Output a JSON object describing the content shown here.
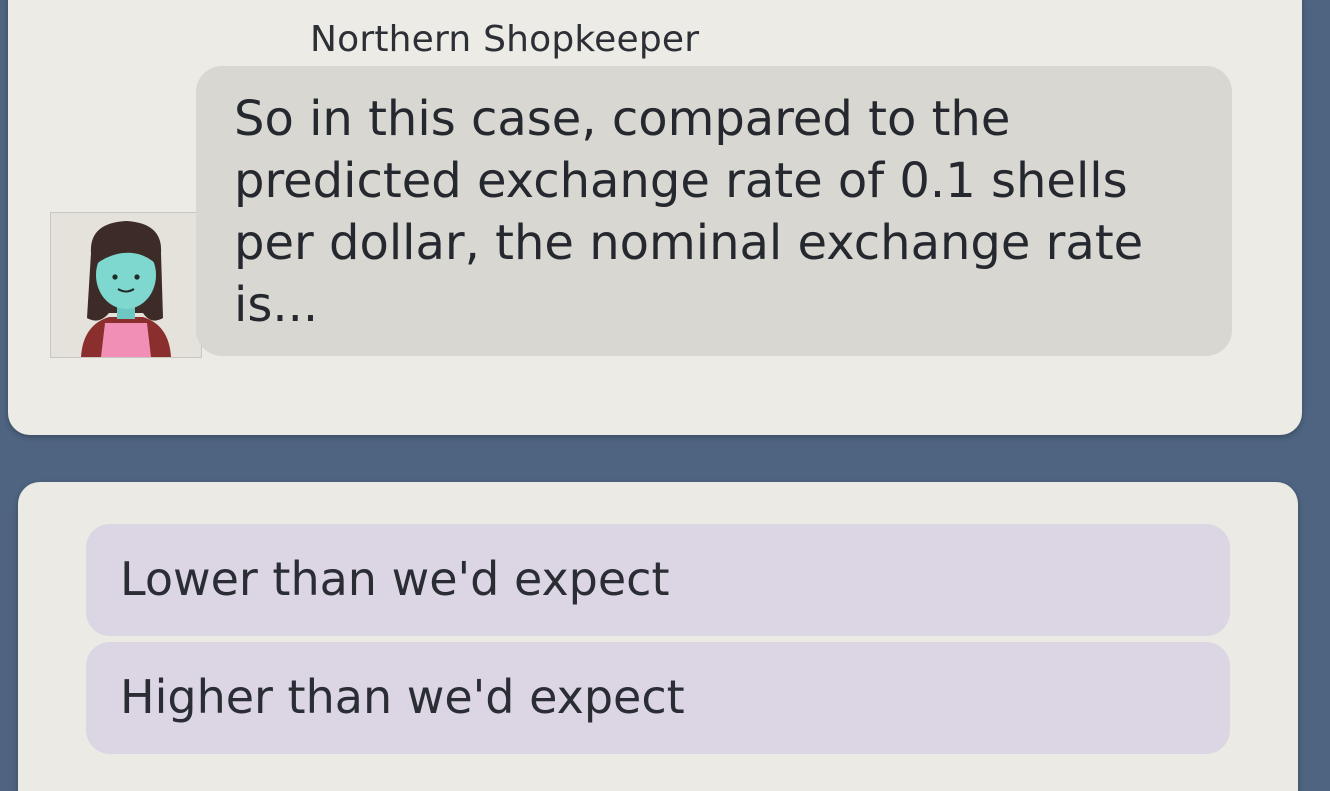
{
  "dialog": {
    "speaker_name": "Northern Shopkeeper",
    "message": "So in this case, compared to the predicted exchange rate of 0.1 shells per dollar, the nominal exchange rate is...",
    "avatar_icon": "shopkeeper-avatar"
  },
  "options": [
    {
      "label": "Lower than we'd expect"
    },
    {
      "label": "Higher than we'd expect"
    }
  ],
  "colors": {
    "background": "#4e6480",
    "card": "#ecebe5",
    "bubble": "#d8d7d1",
    "option": "#dcd5e3",
    "avatar_skin": "#7fd8cf",
    "avatar_apron": "#f28fb6"
  }
}
